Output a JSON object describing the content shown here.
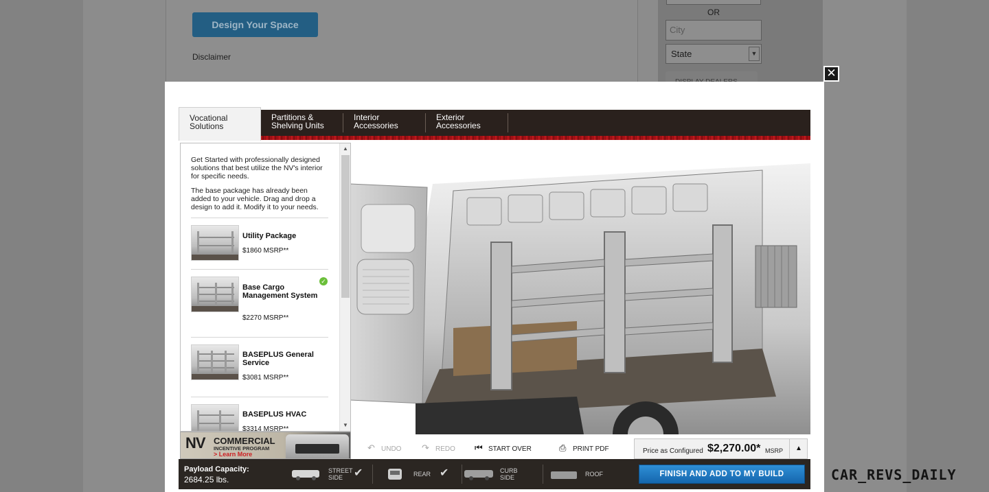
{
  "background": {
    "design_button": "Design Your Space",
    "disclaimer": "Disclaimer",
    "or_label": "OR",
    "city_placeholder": "City",
    "state_value": "State",
    "display_dealers": "DISPLAY DEALERS"
  },
  "modal": {
    "close_icon": "close-icon",
    "tabs": [
      {
        "line1": "Vocational",
        "line2": "Solutions",
        "active": true
      },
      {
        "line1": "Partitions &",
        "line2": "Shelving Units",
        "active": false
      },
      {
        "line1": "Interior",
        "line2": "Accessories",
        "active": false
      },
      {
        "line1": "Exterior",
        "line2": "Accessories",
        "active": false
      }
    ],
    "panel": {
      "intro": "Get Started with professionally designed solutions that best utilize the NV's interior for specific needs.",
      "instructions": "The base package has already been added to your vehicle. Drag and drop a design to add it. Modify it to your needs.",
      "packages": [
        {
          "name": "Utility Package",
          "price": "$1860 MSRP**",
          "selected": false
        },
        {
          "name": "Base Cargo Management System",
          "price": "$2270 MSRP**",
          "selected": true
        },
        {
          "name": "BASEPLUS General Service",
          "price": "$3081 MSRP**",
          "selected": false
        },
        {
          "name": "BASEPLUS HVAC",
          "price": "$3314 MSRP**",
          "selected": false
        }
      ]
    },
    "banner": {
      "nv": "NV",
      "commercial": "COMMERCIAL",
      "incentive": "INCENTIVE PROGRAM",
      "learn_more": "> Learn More"
    },
    "toolbar": {
      "undo": "UNDO",
      "redo": "REDO",
      "start_over": "START OVER",
      "print_pdf": "PRINT PDF"
    },
    "price": {
      "label": "Price as Configured",
      "value": "$2,270.00*",
      "msrp": "MSRP"
    },
    "bottom": {
      "payload_label": "Payload Capacity:",
      "payload_value": "2684.25 lbs.",
      "views": [
        {
          "line1": "STREET",
          "line2": "SIDE",
          "checked": true
        },
        {
          "line1": "REAR",
          "line2": "",
          "checked": true
        },
        {
          "line1": "CURB",
          "line2": "SIDE",
          "checked": false
        },
        {
          "line1": "ROOF",
          "line2": "",
          "checked": false
        }
      ],
      "finish": "FINISH AND ADD TO MY BUILD"
    }
  },
  "watermark": "CAR_REVS_DAILY",
  "colors": {
    "tab_bar": "#2a211d",
    "accent_red": "#c81a1e",
    "finish_blue": "#1f7cc4",
    "check_green": "#6bbf3a"
  }
}
